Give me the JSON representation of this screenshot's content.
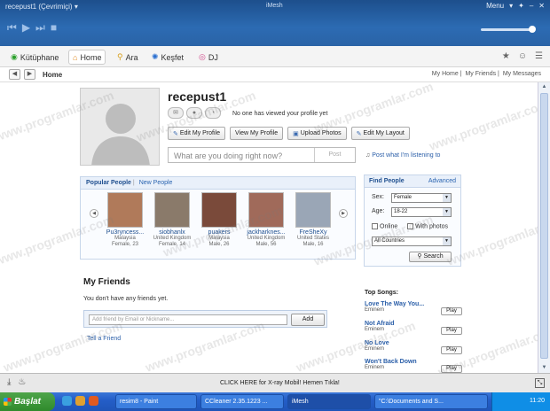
{
  "window": {
    "title": "recepust1 (Çevrimiçi)",
    "app_name": "iMesh",
    "menu_label": "Menu"
  },
  "nav": {
    "tabs": [
      {
        "label": "Kütüphane",
        "icon": "library-icon"
      },
      {
        "label": "Home",
        "icon": "home-icon"
      },
      {
        "label": "Ara",
        "icon": "search-icon"
      },
      {
        "label": "Keşfet",
        "icon": "discover-icon"
      },
      {
        "label": "DJ",
        "icon": "dj-icon"
      }
    ]
  },
  "breadcrumb": {
    "current": "Home",
    "links": [
      "My Home",
      "My Friends",
      "My Messages"
    ]
  },
  "profile": {
    "username": "recepust1",
    "views_text": "No one has viewed your profile yet",
    "buttons": [
      "Edit My Profile",
      "View My Profile",
      "Upload Photos",
      "Edit My Layout"
    ],
    "status_placeholder": "What are you doing right now?",
    "post_label": "Post",
    "listen_link": "Post what I'm listening to"
  },
  "popular": {
    "tab_popular": "Popular People",
    "separator": "|",
    "tab_new": "New People",
    "people": [
      {
        "name": "Pu3ryncess...",
        "country": "Malaysia",
        "info": "Female, 23",
        "color": "#b07a5a"
      },
      {
        "name": "siobhanlx",
        "country": "United Kingdom",
        "info": "Female, 14",
        "color": "#8a7a6a"
      },
      {
        "name": "puakers",
        "country": "Malaysia",
        "info": "Male, 26",
        "color": "#7a4a3a"
      },
      {
        "name": "jackharknes...",
        "country": "United Kingdom",
        "info": "Male, 56",
        "color": "#a06a5a"
      },
      {
        "name": "FreSheXy",
        "country": "United States",
        "info": "Male, 16",
        "color": "#9aa6b6"
      }
    ]
  },
  "find_people": {
    "title": "Find People",
    "advanced": "Advanced",
    "sex_label": "Sex:",
    "sex_value": "Female",
    "age_label": "Age:",
    "age_value": "18-22",
    "online_label": "Online",
    "photos_label": "With photos",
    "country_value": "All Countries",
    "search_label": "Search"
  },
  "friends": {
    "title": "My Friends",
    "empty_text": "You don't have any friends yet.",
    "add_placeholder": "Add friend by Email or Nickname...",
    "add_label": "Add",
    "tell_friend": "Tell a Friend"
  },
  "songs": {
    "title": "Top Songs:",
    "items": [
      {
        "title": "Love The Way You...",
        "artist": "Eminem",
        "play": "Play"
      },
      {
        "title": "Not Afraid",
        "artist": "Eminem",
        "play": "Play"
      },
      {
        "title": "No Love",
        "artist": "Eminem",
        "play": "Play"
      },
      {
        "title": "Won't Back Down",
        "artist": "Eminem",
        "play": "Play"
      }
    ]
  },
  "bottom": {
    "promo": "CLICK HERE for X-ray Mobil! Hemen Tıkla!"
  },
  "taskbar": {
    "start": "Başlat",
    "tasks": [
      "resim8 - Paint",
      "CCleaner 2.35.1223 ...",
      "iMesh",
      "\"C:\\Documents and S..."
    ],
    "clock": "11:20"
  },
  "watermark": "www.programlar.com"
}
